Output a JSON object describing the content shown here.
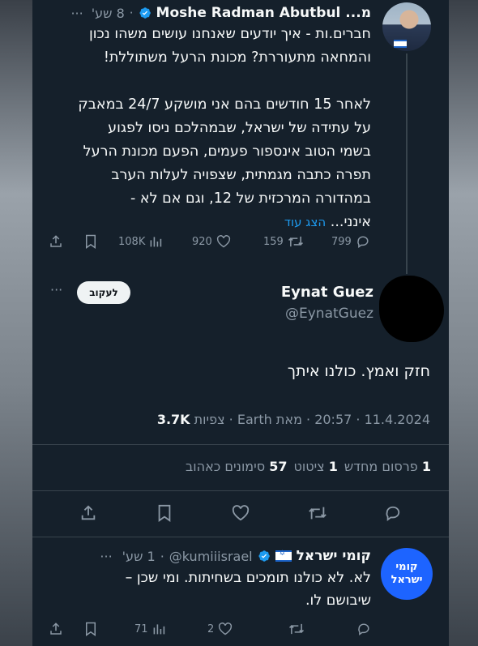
{
  "tweet1": {
    "display_name": "Moshe Radman Abutbul ...מ",
    "time": "8 שע'",
    "more": "···",
    "body_lines": [
      "חברים.ות - איך יודעים שאנחנו עושים משהו נכון",
      "והמחאה מתעוררת? מכונת הרעל משתוללת!",
      "",
      "לאחר 15 חודשים בהם אני מושקע 24/7 במאבק",
      "על עתידה של ישראל, שבמהלכם ניסו לפגוע",
      "בשמי הטוב אינספור פעמים, הפעם מכונת הרעל",
      "תפרה כתבה מגמתית, שצפויה לעלות הערב",
      "במהדורה המרכזית של 12, וגם אם לא -"
    ],
    "last_line": "אינני...",
    "show_more": "הצג עוד",
    "replies": "799",
    "retweets": "159",
    "likes": "920",
    "views": "108K"
  },
  "tweet2": {
    "display_name": "Eynat Guez",
    "handle": "@EynatGuez",
    "follow_label": "לעקוב",
    "more": "···",
    "body": "חזק ואמץ. כולנו איתך",
    "timestamp": "11.4.2024 · 20:57 · מאת Earth",
    "views_count": "3.7K",
    "views_label": "צפיות",
    "reposts_count": "1",
    "reposts_label": "פרסום מחדש",
    "quotes_count": "1",
    "quotes_label": "ציטוט",
    "likes_count": "57",
    "likes_label": "סימונים כאהוב"
  },
  "tweet3": {
    "display_name": "קומי ישראל",
    "handle": "@kumiiisrael",
    "time": "1 שע'",
    "more": "···",
    "avatar_text_1": "קומי",
    "avatar_text_2": "ישראל",
    "body_lines": [
      "לא. לא כולנו תומכים בשחיתות. ומי שכן –",
      "שיבושם לו."
    ],
    "likes": "2",
    "views": "71"
  },
  "colors": {
    "background": "#15202b",
    "text": "#e7e9ea",
    "muted": "#8b98a5",
    "accent": "#1d9bf0",
    "divider": "#38444d"
  }
}
